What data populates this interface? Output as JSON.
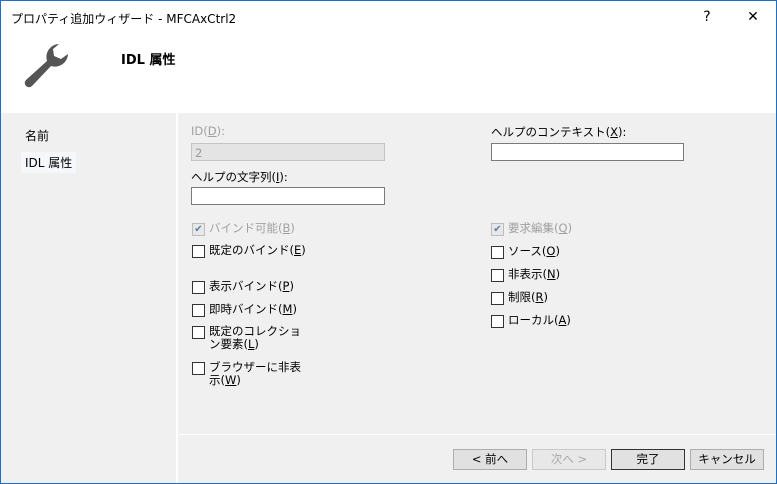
{
  "window": {
    "title": "プロパティ追加ウィザード - MFCAxCtrl2",
    "help": "?",
    "close": "✕"
  },
  "header": {
    "title": "IDL 属性",
    "icon": "wrench-icon"
  },
  "sidebar": {
    "items": [
      {
        "label": "名前",
        "selected": false
      },
      {
        "label": "IDL 属性",
        "selected": true
      }
    ]
  },
  "form": {
    "id_label": "ID(D):",
    "id_value": "2",
    "help_string_label": "ヘルプの文字列(I):",
    "help_string_value": "",
    "help_context_label": "ヘルプのコンテキスト(X):",
    "help_context_value": "",
    "left_checks": [
      {
        "label": "バインド可能(B)",
        "checked": true,
        "disabled": true
      },
      {
        "label": "既定のバインド(E)",
        "checked": false
      },
      {
        "label": "表示バインド(P)",
        "checked": false
      },
      {
        "label": "即時バインド(M)",
        "checked": false
      },
      {
        "label": "既定のコレクション要素(L)",
        "checked": false
      },
      {
        "label": "ブラウザーに非表示(W)",
        "checked": false
      }
    ],
    "right_checks": [
      {
        "label": "要求編集(Q)",
        "checked": true,
        "disabled": true
      },
      {
        "label": "ソース(O)",
        "checked": false
      },
      {
        "label": "非表示(N)",
        "checked": false
      },
      {
        "label": "制限(R)",
        "checked": false
      },
      {
        "label": "ローカル(A)",
        "checked": false
      }
    ]
  },
  "footer": {
    "prev": "< 前へ",
    "next": "次へ >",
    "finish": "完了",
    "cancel": "キャンセル"
  }
}
